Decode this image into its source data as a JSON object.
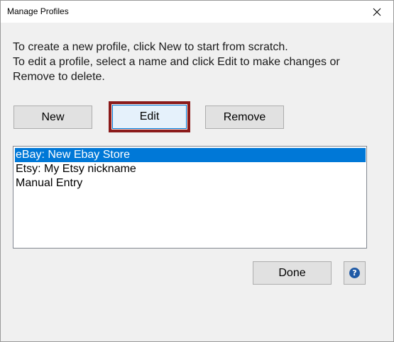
{
  "window": {
    "title": "Manage Profiles",
    "close_glyph": "✕"
  },
  "instructions": {
    "line1": "To create a new profile, click New to start from scratch.",
    "line2": "To edit a profile, select a name and click Edit to make changes or",
    "line3": "Remove to delete."
  },
  "actions": {
    "new_label": "New",
    "edit_label": "Edit",
    "remove_label": "Remove"
  },
  "profiles": {
    "selected_index": 0,
    "items": [
      {
        "label": "eBay: New Ebay Store"
      },
      {
        "label": "Etsy: My Etsy nickname"
      },
      {
        "label": "Manual Entry"
      }
    ]
  },
  "footer": {
    "done_label": "Done",
    "help_glyph": "?"
  },
  "colors": {
    "selection": "#0078d7",
    "highlight_frame": "#8b1a1a",
    "help_icon": "#1f5aa6"
  },
  "icons": {
    "close": "close-icon",
    "help": "help-icon"
  }
}
